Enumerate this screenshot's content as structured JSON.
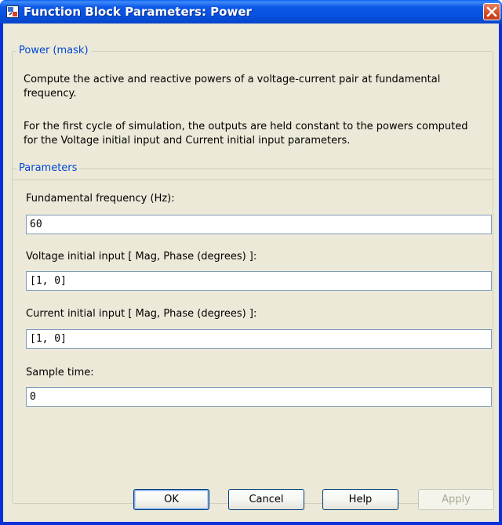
{
  "window": {
    "title": "Function Block Parameters: Power"
  },
  "mask": {
    "legend": "Power (mask)",
    "description_1": "Compute the active and reactive powers of a voltage-current pair at fundamental frequency.",
    "description_2": "For the first cycle of simulation, the outputs are held constant to the powers computed for the Voltage initial input and Current initial input parameters."
  },
  "parameters": {
    "legend": "Parameters",
    "fields": [
      {
        "label": "Fundamental frequency (Hz):",
        "value": "60"
      },
      {
        "label": "Voltage initial input [ Mag, Phase (degrees) ]:",
        "value": "[1, 0]"
      },
      {
        "label": "Current initial input [ Mag, Phase (degrees) ]:",
        "value": "[1, 0]"
      },
      {
        "label": "Sample time:",
        "value": "0"
      }
    ]
  },
  "buttons": {
    "ok": "OK",
    "cancel": "Cancel",
    "help": "Help",
    "apply": "Apply"
  },
  "icons": {
    "app": "simulink-block-icon",
    "close": "close-icon"
  }
}
